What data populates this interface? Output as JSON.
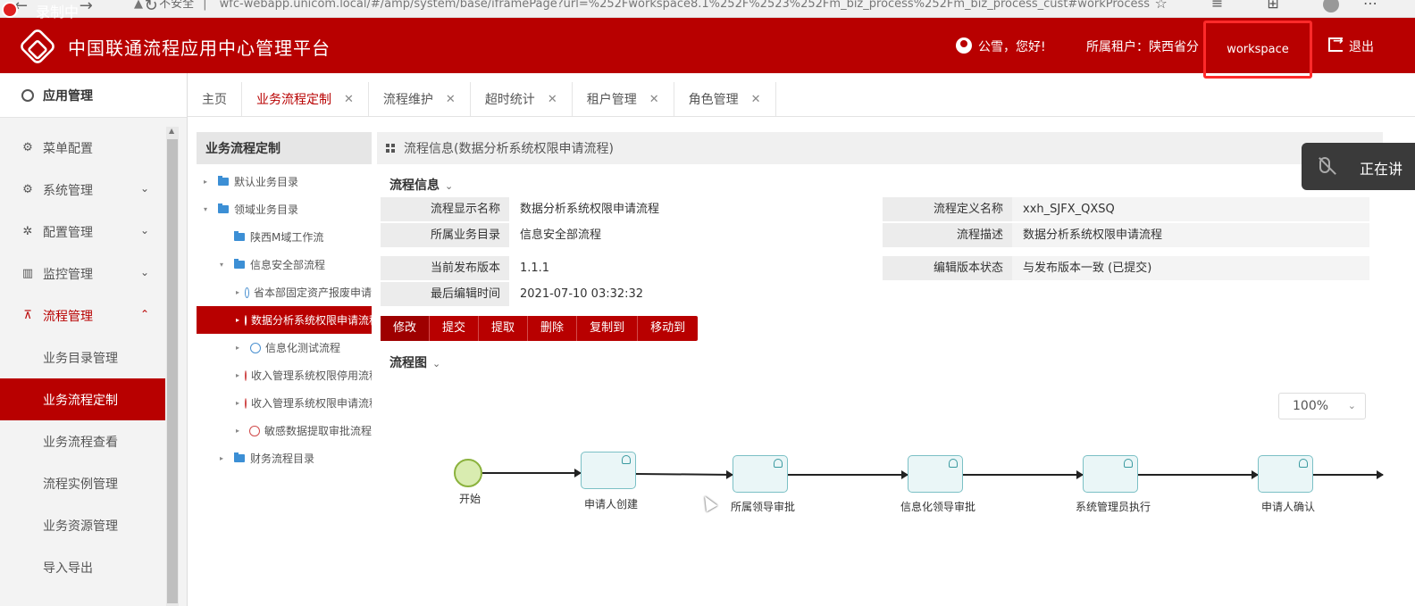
{
  "browser": {
    "url_prefix": "不安全",
    "url": "wfc-webapp.unicom.local/#/amp/system/base/iframePage?url=%252Fworkspace8.1%252F%2523%252Fm_biz_process%252Fm_biz_process_cust#workProcess"
  },
  "recording": {
    "label": "录制中"
  },
  "header": {
    "title": "中国联通流程应用中心管理平台",
    "greeting": "公雪，您好!",
    "tenant": "所属租户：陕西省分",
    "workspace": "workspace",
    "logout": "退出",
    "accent": "#b80000"
  },
  "sidebar": {
    "title": "应用管理",
    "items": [
      {
        "label": "菜单配置",
        "icon": "gear-icon"
      },
      {
        "label": "系统管理",
        "icon": "settings-icon"
      },
      {
        "label": "配置管理",
        "icon": "config-icon"
      },
      {
        "label": "监控管理",
        "icon": "chart-icon"
      },
      {
        "label": "流程管理",
        "icon": "flow-icon"
      }
    ],
    "subitems": [
      {
        "label": "业务目录管理"
      },
      {
        "label": "业务流程定制"
      },
      {
        "label": "业务流程查看"
      },
      {
        "label": "流程实例管理"
      },
      {
        "label": "业务资源管理"
      },
      {
        "label": "导入导出"
      }
    ]
  },
  "tabs": [
    {
      "label": "主页"
    },
    {
      "label": "业务流程定制"
    },
    {
      "label": "流程维护"
    },
    {
      "label": "超时统计"
    },
    {
      "label": "租户管理"
    },
    {
      "label": "角色管理"
    }
  ],
  "tree": {
    "title": "业务流程定制",
    "nodes": [
      {
        "label": "默认业务目录"
      },
      {
        "label": "领域业务目录"
      },
      {
        "label": "陕西M域工作流"
      },
      {
        "label": "信息安全部流程"
      },
      {
        "label": "省本部固定资产报废申请"
      },
      {
        "label": "数据分析系统权限申请流程"
      },
      {
        "label": "信息化测试流程"
      },
      {
        "label": "收入管理系统权限停用流程"
      },
      {
        "label": "收入管理系统权限申请流程"
      },
      {
        "label": "敏感数据提取审批流程"
      },
      {
        "label": "财务流程目录"
      }
    ]
  },
  "main": {
    "header": "流程信息(数据分析系统权限申请流程)",
    "info_section": "流程信息",
    "fields": {
      "display_name_label": "流程显示名称",
      "display_name": "数据分析系统权限申请流程",
      "def_name_label": "流程定义名称",
      "def_name": "xxh_SJFX_QXSQ",
      "category_label": "所属业务目录",
      "category": "信息安全部流程",
      "desc_label": "流程描述",
      "desc": "数据分析系统权限申请流程",
      "version_label": "当前发布版本",
      "version": "1.1.1",
      "edit_status_label": "编辑版本状态",
      "edit_status": "与发布版本一致 (已提交)",
      "last_edit_label": "最后编辑时间",
      "last_edit": "2021-07-10 03:32:32"
    },
    "toolbar": [
      "修改",
      "提交",
      "提取",
      "删除",
      "复制到",
      "移动到"
    ],
    "diagram_section": "流程图",
    "zoom": "100%",
    "diagram_nodes": [
      "开始",
      "申请人创建",
      "所属领导审批",
      "信息化领导审批",
      "系统管理员执行",
      "申请人确认"
    ]
  },
  "overlay": {
    "text": "正在讲"
  }
}
